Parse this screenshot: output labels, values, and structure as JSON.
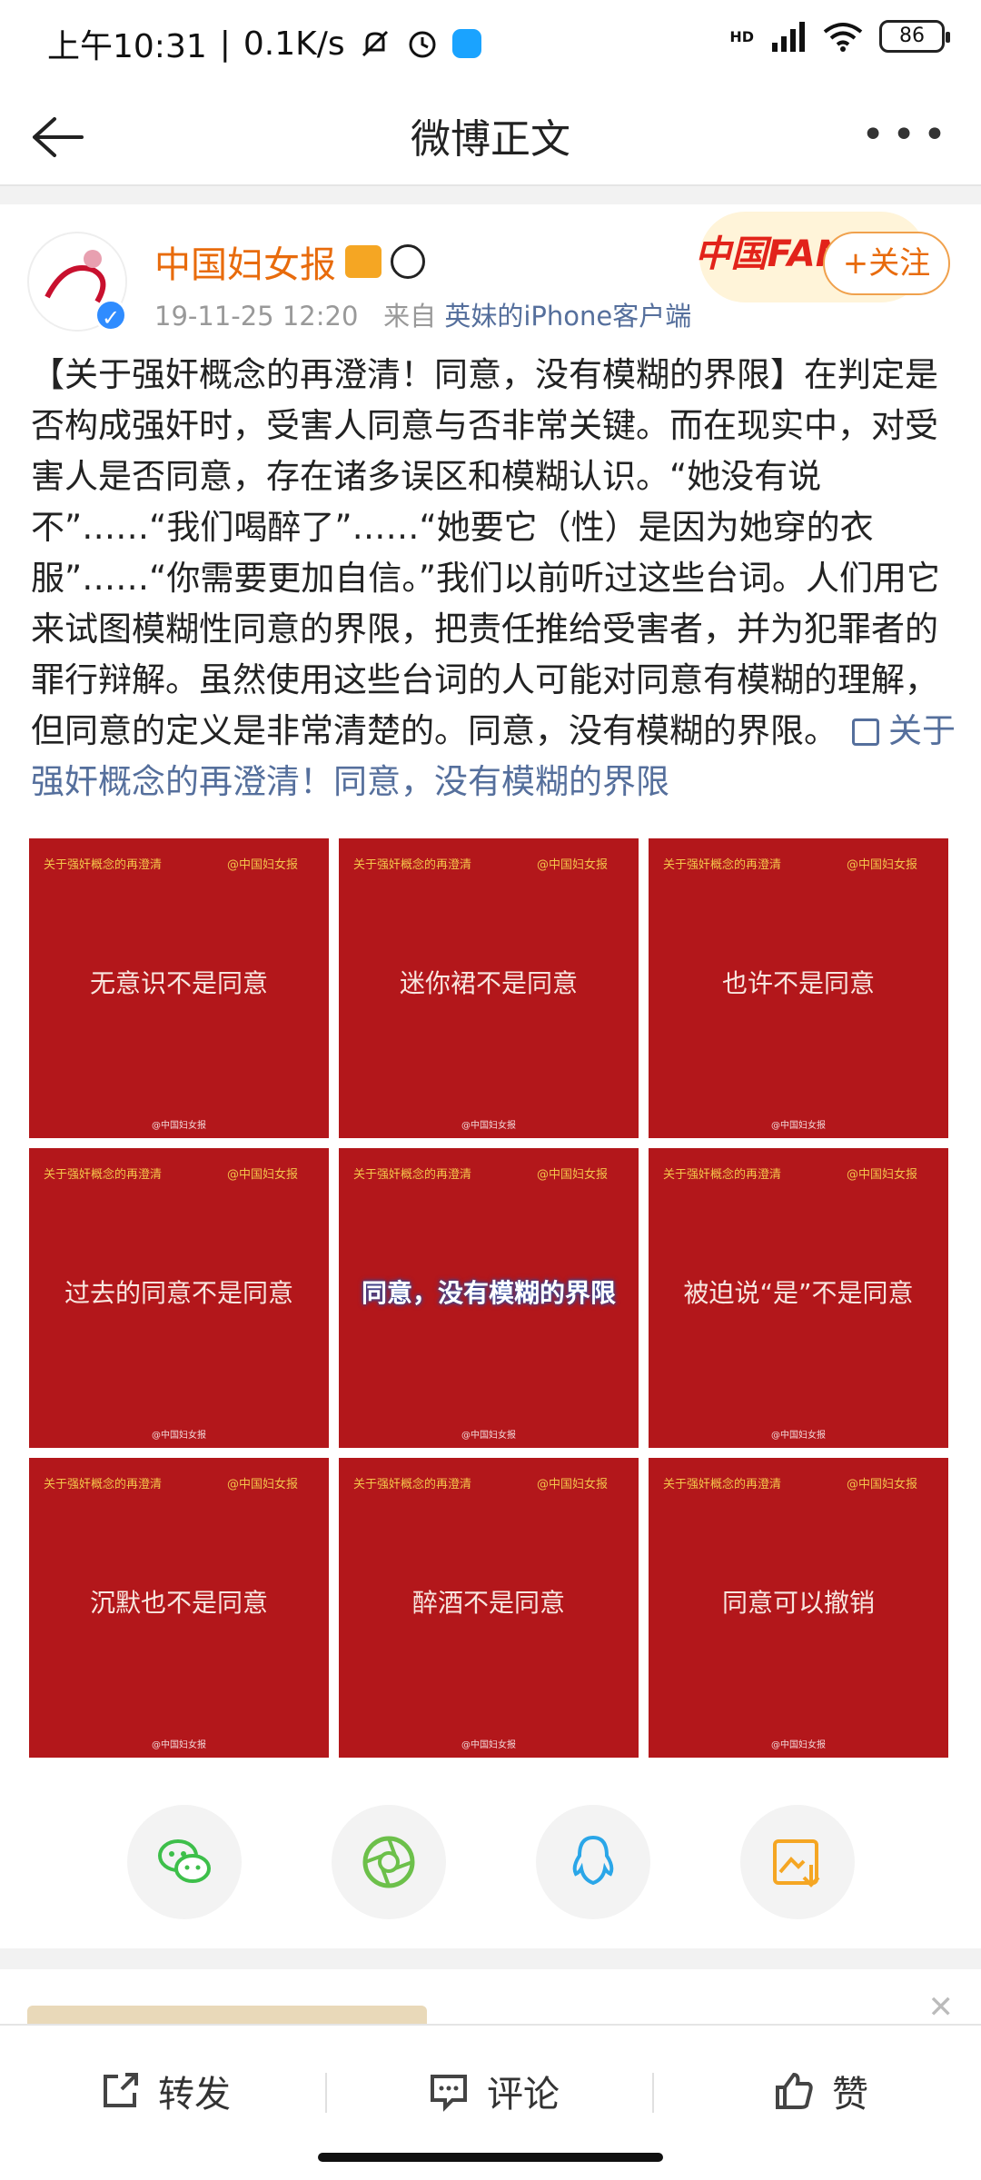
{
  "status_bar": {
    "time": "上午10:31",
    "net_speed": "0.1K/s",
    "signal_label": "HD",
    "battery": "86"
  },
  "nav": {
    "title": "微博正文"
  },
  "post": {
    "author": "中国妇女报",
    "timestamp": "19-11-25 12:20",
    "source_prefix": "来自",
    "source": "英妹的iPhone客户端",
    "fans_badge": "中国FANS",
    "follow_label": "+关注",
    "text": "【关于强奸概念的再澄清！同意，没有模糊的界限】在判定是否构成强奸时，受害人同意与否非常关键。而在现实中，对受害人是否同意，存在诸多误区和模糊认识。“她没有说不”……“我们喝醉了”……“她要它（性）是因为她穿的衣服”……“你需要更加自信。”我们以前听过这些台词。人们用它来试图模糊性同意的界限，把责任推给受害者，并为犯罪者的罪行辩解。虽然使用这些台词的人可能对同意有模糊的理解，但同意的定义是非常清楚的。同意，没有模糊的界限。",
    "link_text": "关于强奸概念的再澄清！同意，没有模糊的界限",
    "images": {
      "corner_left": "关于强奸概念的再澄清",
      "corner_right": "@中国妇女报",
      "footer": "@中国妇女报",
      "tile1": "无意识不是同意",
      "tile2": "迷你裙不是同意",
      "tile3": "也许不是同意",
      "tile4": "过去的同意不是同意",
      "tile5": "同意，没有模糊的界限",
      "tile6": "被迫说“是”不是同意",
      "tile7": "沉默也不是同意",
      "tile8": "醉酒不是同意",
      "tile9": "同意可以撤销"
    }
  },
  "share": {
    "wechat_icon": "wechat-icon",
    "moments_icon": "moments-icon",
    "qq_icon": "qq-icon",
    "save_icon": "save-image-icon"
  },
  "bottom_bar": {
    "repost": "转发",
    "comment": "评论",
    "like": "赞"
  },
  "colors": {
    "brand_orange": "#e86b0c",
    "link_blue": "#556f9c",
    "tile_red": "#b3171b",
    "wechat_green": "#3dbf4a",
    "qq_blue": "#2aa6e8",
    "save_orange": "#f5a623"
  }
}
